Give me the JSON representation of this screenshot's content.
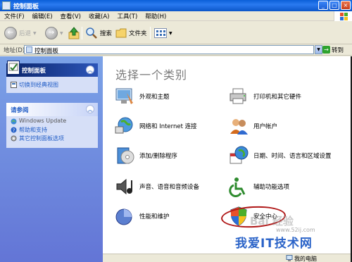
{
  "window": {
    "title": "控制面板"
  },
  "menu": [
    "文件(F)",
    "编辑(E)",
    "查看(V)",
    "收藏(A)",
    "工具(T)",
    "帮助(H)"
  ],
  "toolbar": {
    "back": "后退",
    "search": "搜索",
    "folders": "文件夹"
  },
  "address": {
    "label": "地址(D)",
    "value": "控制面板",
    "go": "转到"
  },
  "left_panel": {
    "control_panel": {
      "title": "控制面板",
      "links": [
        "切换到经典视图"
      ]
    },
    "see_also": {
      "title": "请参阅",
      "links": [
        "Windows Update",
        "帮助和支持",
        "其它控制面板选项"
      ]
    }
  },
  "main": {
    "heading": "选择一个类别",
    "categories": [
      {
        "label": "外观和主题",
        "icon": "appearance-icon"
      },
      {
        "label": "打印机和其它硬件",
        "icon": "printer-icon"
      },
      {
        "label": "网络和 Internet 连接",
        "icon": "network-icon"
      },
      {
        "label": "用户帐户",
        "icon": "user-accounts-icon"
      },
      {
        "label": "添加/删除程序",
        "icon": "add-remove-programs-icon"
      },
      {
        "label": "日期、时间、语言和区域设置",
        "icon": "date-time-icon"
      },
      {
        "label": "声音、语音和音频设备",
        "icon": "sound-icon"
      },
      {
        "label": "辅助功能选项",
        "icon": "accessibility-icon"
      },
      {
        "label": "性能和维护",
        "icon": "performance-icon"
      },
      {
        "label": "安全中心",
        "icon": "security-center-icon"
      }
    ]
  },
  "status": {
    "text": "我的电脑"
  },
  "watermark": {
    "baidu": "Bai 经验",
    "site_cn": "我爱IT技术网",
    "site_url": "www.52ij.com"
  },
  "colors": {
    "accent": "#215dc6",
    "highlight_circle": "#b01818"
  }
}
